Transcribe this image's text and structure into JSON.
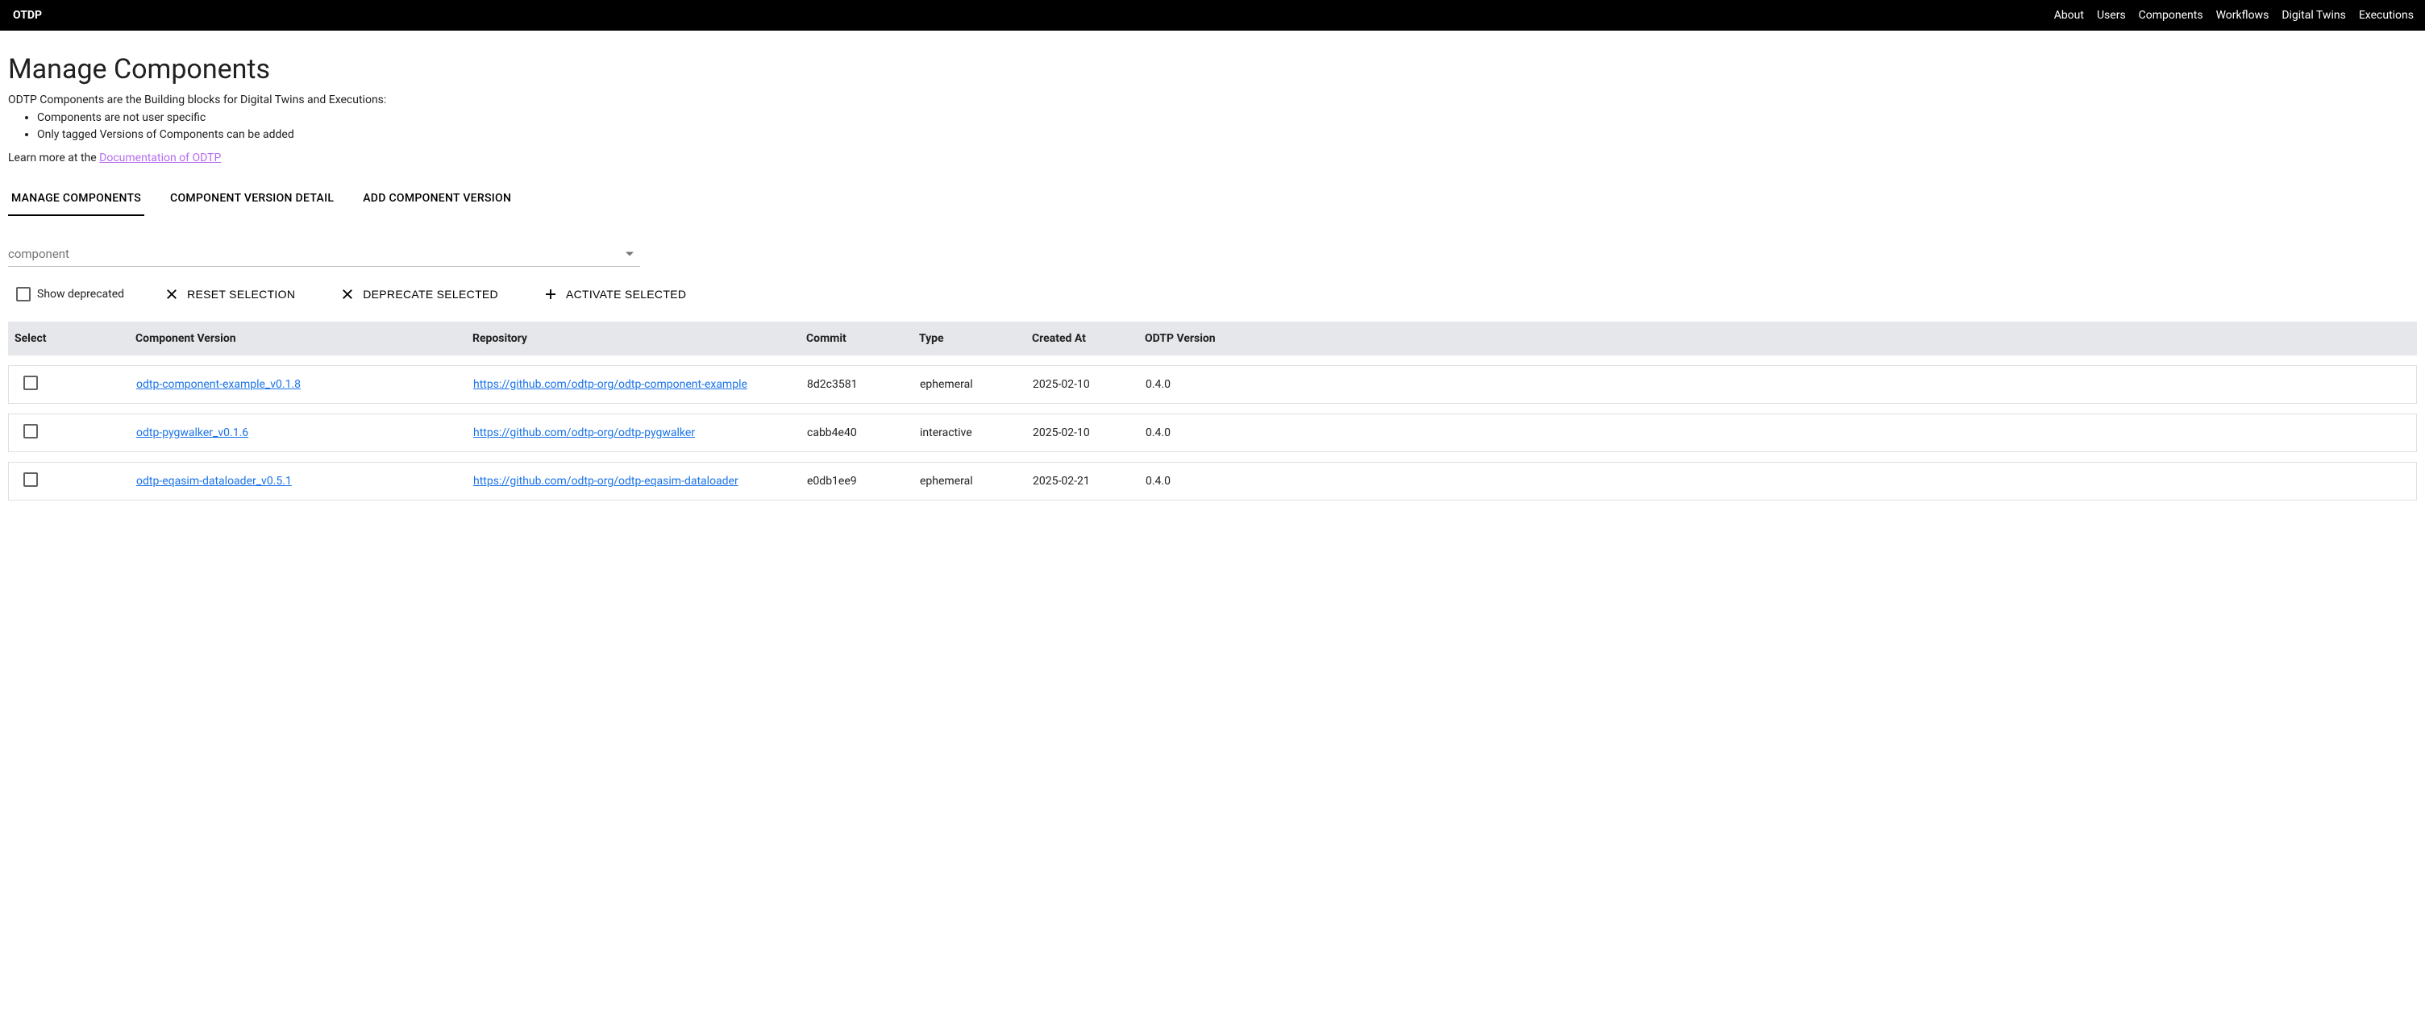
{
  "header": {
    "brand": "OTDP",
    "nav": [
      "About",
      "Users",
      "Components",
      "Workflows",
      "Digital Twins",
      "Executions"
    ]
  },
  "page": {
    "title": "Manage Components",
    "intro": "ODTP Components are the Building blocks for Digital Twins and Executions:",
    "bullets": [
      "Components are not user specific",
      "Only tagged Versions of Components can be added"
    ],
    "learn_more_prefix": "Learn more at the ",
    "doc_link_label": "Documentation of ODTP"
  },
  "tabs": [
    {
      "label": "MANAGE COMPONENTS",
      "active": true
    },
    {
      "label": "COMPONENT VERSION DETAIL",
      "active": false
    },
    {
      "label": "ADD COMPONENT VERSION",
      "active": false
    }
  ],
  "filter": {
    "placeholder": "component"
  },
  "actions": {
    "show_deprecated_label": "Show deprecated",
    "reset_selection": "RESET SELECTION",
    "deprecate_selected": "DEPRECATE SELECTED",
    "activate_selected": "ACTIVATE SELECTED"
  },
  "table": {
    "headers": {
      "select": "Select",
      "version": "Component Version",
      "repo": "Repository",
      "commit": "Commit",
      "type": "Type",
      "created": "Created At",
      "odtp": "ODTP Version"
    },
    "rows": [
      {
        "version": "odtp-component-example_v0.1.8",
        "repo": "https://github.com/odtp-org/odtp-component-example",
        "commit": "8d2c3581",
        "type": "ephemeral",
        "created": "2025-02-10",
        "odtp": "0.4.0"
      },
      {
        "version": "odtp-pygwalker_v0.1.6",
        "repo": "https://github.com/odtp-org/odtp-pygwalker",
        "commit": "cabb4e40",
        "type": "interactive",
        "created": "2025-02-10",
        "odtp": "0.4.0"
      },
      {
        "version": "odtp-eqasim-dataloader_v0.5.1",
        "repo": "https://github.com/odtp-org/odtp-eqasim-dataloader",
        "commit": "e0db1ee9",
        "type": "ephemeral",
        "created": "2025-02-21",
        "odtp": "0.4.0"
      }
    ]
  }
}
